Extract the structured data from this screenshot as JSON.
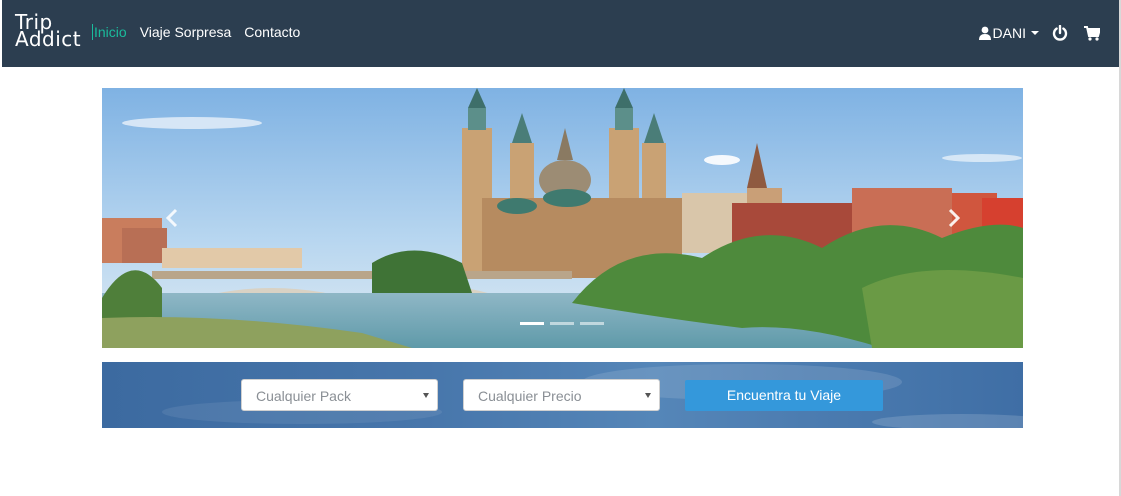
{
  "brand": {
    "line1": "Trip",
    "line2": "Addict"
  },
  "nav": {
    "items": [
      {
        "label": "Inicio",
        "active": true
      },
      {
        "label": "Viaje Sorpresa",
        "active": false
      },
      {
        "label": "Contacto",
        "active": false
      }
    ]
  },
  "user": {
    "name": "DANI",
    "icon": "user-icon"
  },
  "header_icons": {
    "power": "power-icon",
    "cart": "cart-icon"
  },
  "carousel": {
    "slide_count": 3,
    "active_index": 0,
    "prev_icon": "chevron-left-icon",
    "next_icon": "chevron-right-icon"
  },
  "search": {
    "pack_select": {
      "selected": "Cualquier Pack"
    },
    "price_select": {
      "selected": "Cualquier Precio"
    },
    "submit_label": "Encuentra tu Viaje"
  },
  "colors": {
    "navbar": "#2c3e50",
    "active_link": "#1abc9c",
    "button": "#3498db"
  }
}
